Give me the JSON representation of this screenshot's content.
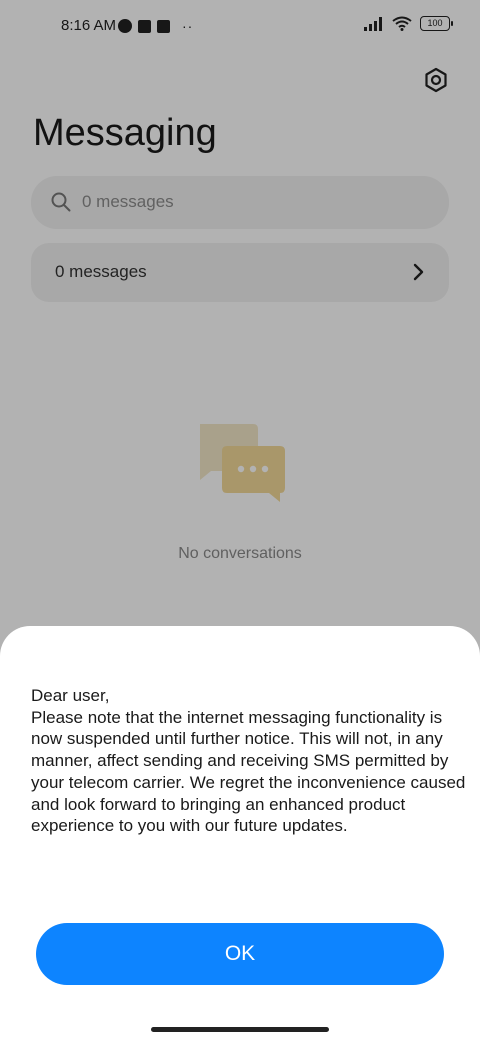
{
  "status_bar": {
    "time": "8:16 AM",
    "battery": "100",
    "more_dots": "··"
  },
  "header": {
    "title": "Messaging"
  },
  "search": {
    "placeholder": "0 messages"
  },
  "messages_row": {
    "label": "0 messages"
  },
  "empty_state": {
    "text": "No conversations"
  },
  "dialog": {
    "message": "Dear user,\nPlease note that the internet messaging functionality is now suspended until further notice. This will not, in any manner, affect sending and receiving SMS permitted by your telecom carrier. We regret the inconvenience caused and look forward to bringing an enhanced product experience to you with our future updates.",
    "ok_label": "OK"
  },
  "colors": {
    "accent": "#0d84ff",
    "scrim": "rgba(0,0,0,0.30)",
    "illustration_back": "#f3e7c7",
    "illustration_front": "#f3d999"
  },
  "icons": {
    "settings": "gear-icon",
    "search": "search-icon",
    "chevron": "chevron-right-icon",
    "empty": "chat-bubbles-icon"
  }
}
